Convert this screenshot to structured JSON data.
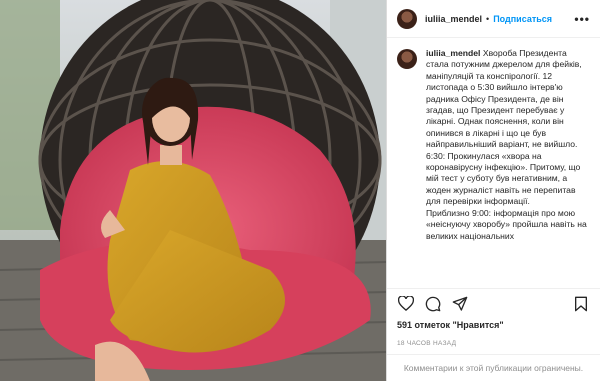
{
  "account": {
    "username": "iuliia_mendel",
    "separator": "•",
    "follow_label": "Подписаться",
    "more_icon": "more-horizontal-icon"
  },
  "caption": {
    "username": "iuliia_mendel",
    "text": "Хвороба Президента стала потужним джерелом для фейків, маніпуляцій та конспірології. 12 листопада о 5:30 вийшло інтерв'ю радника Офісу Президента, де він згадав, що Президент перебуває у лікарні. Однак пояснення, коли він опинився в лікарні і що це був найправильніший варіант, не вийшло.\n6:30: Прокинулася «хвора на коронавірусну інфекцію». Притому, що мій тест у суботу був негативним, а жоден журналіст навіть не перепитав для перевірки інформації.\nПриблизно 9:00: інформація про мою «неіснуючу хворобу» пройшла навіть на великих національних"
  },
  "actions": {
    "like_icon": "heart-icon",
    "comment_icon": "comment-icon",
    "share_icon": "share-icon",
    "save_icon": "bookmark-icon"
  },
  "likes_text": "591 отметок \"Нравится\"",
  "time_text": "18 часов назад",
  "comments_notice": "Комментарии к этой публикации ограничены."
}
